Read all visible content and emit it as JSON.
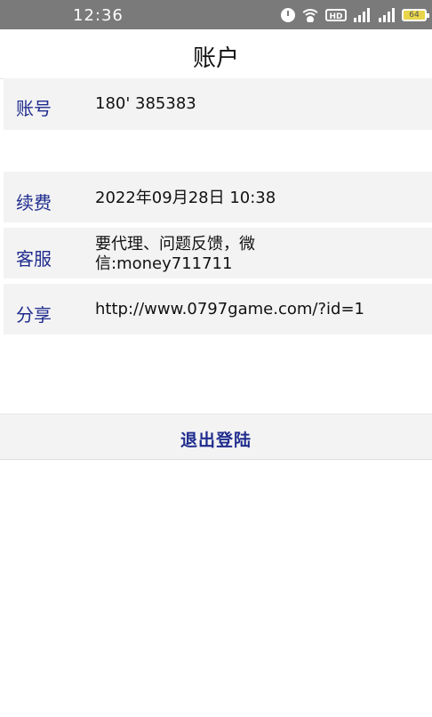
{
  "status_bar": {
    "time": "12:36",
    "battery": "64",
    "hd_label": "HD"
  },
  "header": {
    "title": "账户"
  },
  "rows": [
    {
      "label": "账号",
      "value": "180'  385383"
    },
    {
      "label": "续费",
      "value": "2022年09月28日 10:38"
    },
    {
      "label": "客服",
      "value": "要代理、问题反馈，微信:money711711"
    },
    {
      "label": "分享",
      "value": "http://www.0797game.com/?id=1"
    }
  ],
  "logout": {
    "label": "退出登陆"
  },
  "colors": {
    "label_blue": "#1f2c8e",
    "row_bg": "#f3f3f3",
    "status_bg": "#7a7a7a"
  }
}
